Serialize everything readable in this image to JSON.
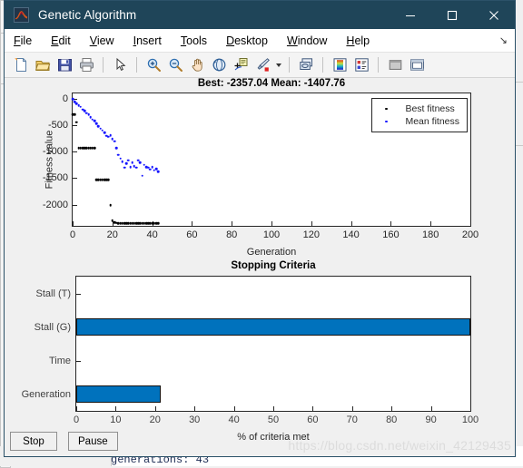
{
  "window": {
    "title": "Genetic Algorithm",
    "icon": "matlab-membrane-icon",
    "minimize_label": "—",
    "maximize_label": "☐",
    "close_label": "✕"
  },
  "menubar": {
    "items": [
      {
        "label": "File",
        "mnemonic": "F",
        "rest": "ile"
      },
      {
        "label": "Edit",
        "mnemonic": "E",
        "rest": "dit"
      },
      {
        "label": "View",
        "mnemonic": "V",
        "rest": "iew"
      },
      {
        "label": "Insert",
        "mnemonic": "I",
        "rest": "nsert"
      },
      {
        "label": "Tools",
        "mnemonic": "T",
        "rest": "ools"
      },
      {
        "label": "Desktop",
        "mnemonic": "D",
        "rest": "esktop"
      },
      {
        "label": "Window",
        "mnemonic": "W",
        "rest": "indow"
      },
      {
        "label": "Help",
        "mnemonic": "H",
        "rest": "elp"
      }
    ],
    "overflow_label": "↘"
  },
  "toolbar": {
    "buttons": [
      {
        "name": "new-figure-icon",
        "tooltip": "New Figure"
      },
      {
        "name": "open-file-icon",
        "tooltip": "Open File"
      },
      {
        "name": "save-figure-icon",
        "tooltip": "Save Figure"
      },
      {
        "name": "print-figure-icon",
        "tooltip": "Print Figure"
      },
      {
        "name": "pointer-icon",
        "tooltip": "Edit Plot"
      },
      {
        "name": "zoom-in-icon",
        "tooltip": "Zoom In"
      },
      {
        "name": "zoom-out-icon",
        "tooltip": "Zoom Out"
      },
      {
        "name": "pan-icon",
        "tooltip": "Pan"
      },
      {
        "name": "rotate-3d-icon",
        "tooltip": "Rotate 3D"
      },
      {
        "name": "data-cursor-icon",
        "tooltip": "Data Cursor"
      },
      {
        "name": "brush-icon",
        "tooltip": "Brush/Select Data"
      },
      {
        "name": "link-data-icon",
        "tooltip": "Link Plot"
      },
      {
        "name": "colorbar-icon",
        "tooltip": "Insert Colorbar"
      },
      {
        "name": "legend-icon",
        "tooltip": "Insert Legend"
      },
      {
        "name": "hide-plot-tools-icon",
        "tooltip": "Hide Plot Tools"
      },
      {
        "name": "show-plot-tools-icon",
        "tooltip": "Show Plot Tools"
      }
    ]
  },
  "chart_data": [
    {
      "type": "scatter",
      "id": "fitness-plot",
      "title": "Best: -2357.04 Mean: -1407.76",
      "best_value": -2357.04,
      "mean_value": -1407.76,
      "xlabel": "Generation",
      "ylabel": "Fitness value",
      "xlim": [
        0,
        200
      ],
      "ylim": [
        -2400,
        100
      ],
      "xticks": [
        0,
        20,
        40,
        60,
        80,
        100,
        120,
        140,
        160,
        180,
        200
      ],
      "yticks": [
        0,
        -500,
        -1000,
        -1500,
        -2000
      ],
      "grid": false,
      "legend_position": "top-right",
      "series": [
        {
          "name": "Best fitness",
          "color": "#000000",
          "x": [
            0,
            1,
            2,
            3,
            4,
            5,
            6,
            7,
            8,
            9,
            10,
            11,
            12,
            13,
            14,
            15,
            16,
            17,
            18,
            19,
            20,
            21,
            22,
            23,
            24,
            25,
            26,
            27,
            28,
            29,
            30,
            31,
            32,
            33,
            34,
            35,
            36,
            37,
            38,
            39,
            40,
            41,
            42,
            43
          ],
          "y": [
            -300,
            -300,
            -440,
            -930,
            -930,
            -930,
            -930,
            -930,
            -930,
            -930,
            -930,
            -930,
            -1530,
            -1530,
            -1530,
            -1530,
            -1530,
            -1530,
            -1530,
            -2010,
            -2300,
            -2330,
            -2345,
            -2357,
            -2357,
            -2357,
            -2357,
            -2357,
            -2357,
            -2357,
            -2357,
            -2357,
            -2357,
            -2357,
            -2357,
            -2357,
            -2357,
            -2357,
            -2357,
            -2357,
            -2357,
            -2357,
            -2357,
            -2357
          ]
        },
        {
          "name": "Mean fitness",
          "color": "#1414ff",
          "x": [
            0,
            1,
            2,
            3,
            4,
            5,
            6,
            7,
            8,
            9,
            10,
            11,
            12,
            13,
            14,
            15,
            16,
            17,
            18,
            19,
            20,
            21,
            22,
            23,
            24,
            25,
            26,
            27,
            28,
            29,
            30,
            31,
            32,
            33,
            34,
            35,
            36,
            37,
            38,
            39,
            40,
            41,
            42,
            43
          ],
          "y": [
            -10,
            -60,
            -90,
            -130,
            -150,
            -200,
            -230,
            -270,
            -300,
            -350,
            -390,
            -420,
            -470,
            -520,
            -560,
            -600,
            -640,
            -700,
            -720,
            -690,
            -760,
            -800,
            -930,
            -1060,
            -1130,
            -1190,
            -1300,
            -1220,
            -1160,
            -1290,
            -1200,
            -1270,
            -1300,
            -1160,
            -1200,
            -1450,
            -1250,
            -1290,
            -1300,
            -1330,
            -1290,
            -1350,
            -1320,
            -1380
          ]
        }
      ]
    },
    {
      "type": "bar",
      "id": "stopping-criteria-plot",
      "orientation": "horizontal",
      "title": "Stopping Criteria",
      "xlabel": "% of criteria met",
      "ylabel": "",
      "xlim": [
        0,
        100
      ],
      "xticks": [
        0,
        10,
        20,
        30,
        40,
        50,
        60,
        70,
        80,
        90,
        100
      ],
      "categories": [
        "Generation",
        "Time",
        "Stall (G)",
        "Stall (T)"
      ],
      "values": [
        21.5,
        0,
        100,
        0
      ],
      "bar_color": "#0072bd",
      "grid": false
    }
  ],
  "legend": {
    "entries": [
      {
        "label": "Best fitness",
        "color": "#000000"
      },
      {
        "label": "Mean fitness",
        "color": "#1414ff"
      }
    ]
  },
  "controls": {
    "stop_label": "Stop",
    "pause_label": "Pause"
  },
  "watermark": {
    "text": "https://blog.csdn.net/weixin_42129435"
  },
  "background": {
    "console_text": "generations: 43"
  }
}
